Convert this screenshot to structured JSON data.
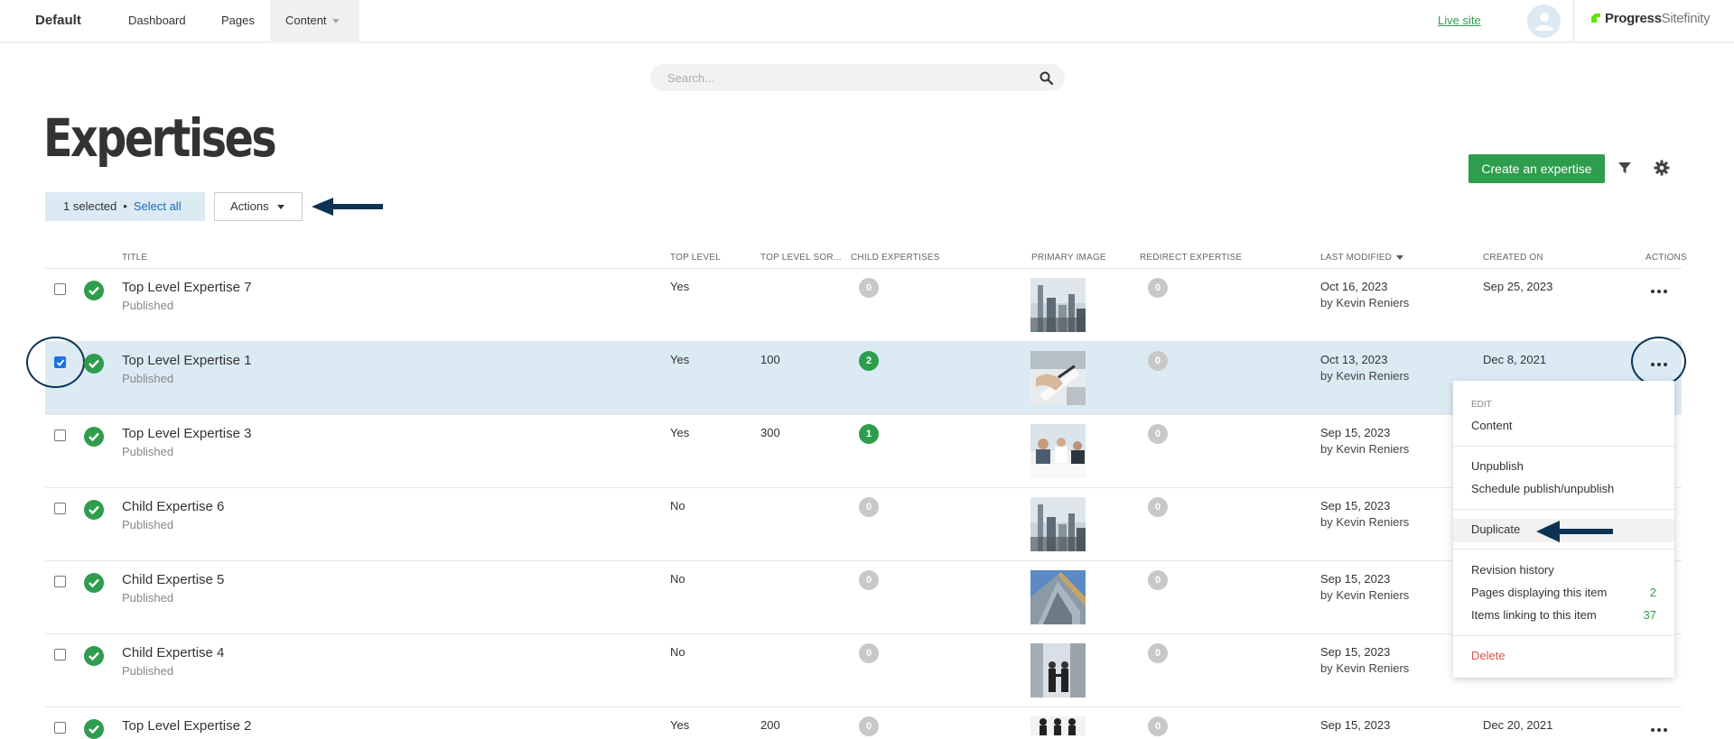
{
  "header": {
    "site_name": "Default",
    "nav": [
      "Dashboard",
      "Pages",
      "Content"
    ],
    "live_site": "Live site",
    "brand_main": "Progress",
    "brand_sub": "Sitefinity"
  },
  "search": {
    "placeholder": "Search..."
  },
  "page": {
    "title": "Expertises",
    "selected_text": "1 selected",
    "dot": "•",
    "select_all": "Select all",
    "actions_label": "Actions",
    "create_button": "Create an expertise"
  },
  "table": {
    "headers": {
      "title": "TITLE",
      "top_level": "TOP LEVEL",
      "top_level_sort": "TOP LEVEL SOR...",
      "child_expertises": "CHILD EXPERTISES",
      "primary_image": "PRIMARY IMAGE",
      "redirect_expertise": "REDIRECT EXPERTISE",
      "last_modified": "LAST MODIFIED",
      "created_on": "CREATED ON",
      "actions": "ACTIONS"
    },
    "rows": [
      {
        "title": "Top Level Expertise 7",
        "status": "Published",
        "top_level": "Yes",
        "sort": "",
        "children": "0",
        "redirect": "0",
        "modified": "Oct 16, 2023",
        "by": "by Kevin Reniers",
        "created": "Sep 25, 2023",
        "image": "city-skyline"
      },
      {
        "title": "Top Level Expertise 1",
        "status": "Published",
        "top_level": "Yes",
        "sort": "100",
        "children": "2",
        "redirect": "0",
        "modified": "Oct 13, 2023",
        "by": "by Kevin Reniers",
        "created": "Dec 8, 2021",
        "image": "writing-hands"
      },
      {
        "title": "Top Level Expertise 3",
        "status": "Published",
        "top_level": "Yes",
        "sort": "300",
        "children": "1",
        "redirect": "0",
        "modified": "Sep 15, 2023",
        "by": "by Kevin Reniers",
        "created": "",
        "image": "office-meeting"
      },
      {
        "title": "Child Expertise 6",
        "status": "Published",
        "top_level": "No",
        "sort": "",
        "children": "0",
        "redirect": "0",
        "modified": "Sep 15, 2023",
        "by": "by Kevin Reniers",
        "created": "",
        "image": "city-skyline"
      },
      {
        "title": "Child Expertise 5",
        "status": "Published",
        "top_level": "No",
        "sort": "",
        "children": "0",
        "redirect": "0",
        "modified": "Sep 15, 2023",
        "by": "by Kevin Reniers",
        "created": "",
        "image": "glass-building"
      },
      {
        "title": "Child Expertise 4",
        "status": "Published",
        "top_level": "No",
        "sort": "",
        "children": "0",
        "redirect": "0",
        "modified": "Sep 15, 2023",
        "by": "by Kevin Reniers",
        "created": "",
        "image": "handshake"
      },
      {
        "title": "Top Level Expertise 2",
        "status": "",
        "top_level": "Yes",
        "sort": "200",
        "children": "0",
        "redirect": "0",
        "modified": "Sep 15, 2023",
        "by": "",
        "created": "Dec 20, 2021",
        "image": "business-people"
      }
    ]
  },
  "menu": {
    "edit_label": "EDIT",
    "content": "Content",
    "unpublish": "Unpublish",
    "schedule": "Schedule publish/unpublish",
    "duplicate": "Duplicate",
    "revision_history": "Revision history",
    "pages_displaying": "Pages displaying this item",
    "pages_displaying_count": "2",
    "items_linking": "Items linking to this item",
    "items_linking_count": "37",
    "delete": "Delete"
  },
  "colors": {
    "accent_green": "#2e9d4d",
    "selection_blue": "#dbeaf3",
    "annotation_navy": "#0c3353",
    "danger_red": "#d9534f"
  }
}
